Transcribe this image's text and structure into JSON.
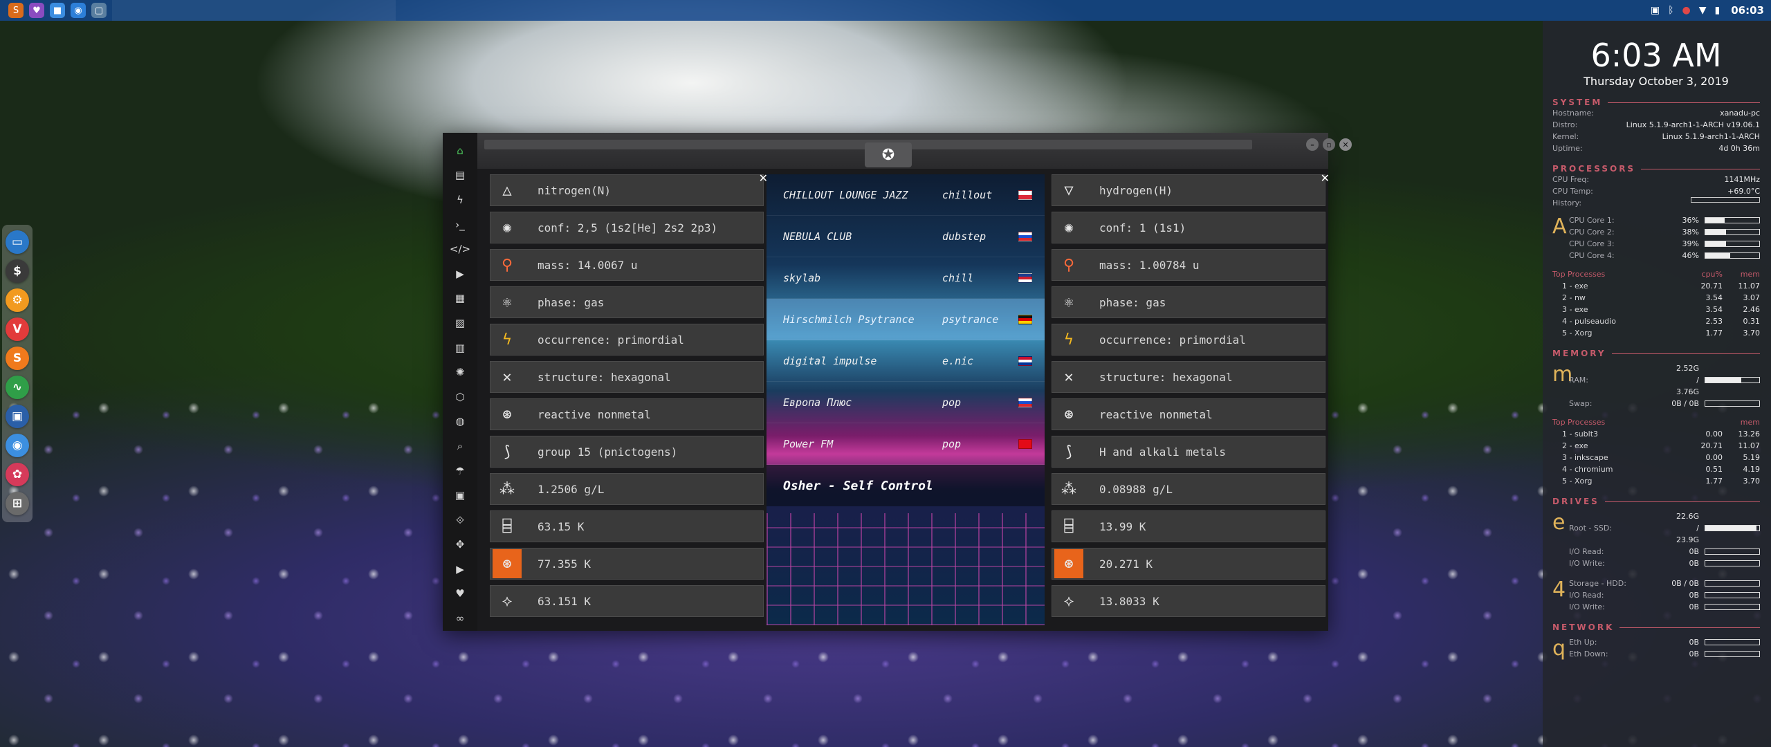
{
  "topbar": {
    "clock": "06:03",
    "launchers": [
      {
        "icon": "app-icon",
        "glyph": "S",
        "color": "#d96b1c"
      },
      {
        "icon": "shield-icon",
        "glyph": "♥",
        "color": "#8a4cc0"
      },
      {
        "icon": "folder-icon",
        "glyph": "■",
        "color": "#3b8de0"
      },
      {
        "icon": "chrome-icon",
        "glyph": "◉",
        "color": "#2d7fd8"
      },
      {
        "icon": "window-icon",
        "glyph": "▢",
        "color": "#5a7fa0"
      }
    ]
  },
  "dock": {
    "items": [
      {
        "icon": "files-icon",
        "glyph": "▭",
        "color": "#2a78c8"
      },
      {
        "icon": "money-icon",
        "glyph": "$",
        "color": "#3a3a3a"
      },
      {
        "icon": "settings-icon",
        "glyph": "⚙",
        "color": "#f29a1f"
      },
      {
        "icon": "vivaldi-icon",
        "glyph": "V",
        "color": "#e23b3b"
      },
      {
        "icon": "sublime-icon",
        "glyph": "S",
        "color": "#f07a1c"
      },
      {
        "icon": "monitor-icon",
        "glyph": "∿",
        "color": "#2f9e48"
      },
      {
        "icon": "display-icon",
        "glyph": "▣",
        "color": "#2a5fa8"
      },
      {
        "icon": "browser-icon",
        "glyph": "◉",
        "color": "#3c8fe0"
      },
      {
        "icon": "badge-icon",
        "glyph": "✿",
        "color": "#d63a5a"
      },
      {
        "icon": "grid-icon",
        "glyph": "⊞",
        "color": "#6a6a6a"
      }
    ]
  },
  "conky": {
    "time": "6:03 AM",
    "date": "Thursday October  3, 2019",
    "system_title": "SYSTEM",
    "system": [
      {
        "k": "Hostname:",
        "v": "xanadu-pc"
      },
      {
        "k": "Distro:",
        "v": "Linux 5.1.9-arch1-1-ARCH v19.06.1"
      },
      {
        "k": "Kernel:",
        "v": "Linux 5.1.9-arch1-1-ARCH"
      },
      {
        "k": "Uptime:",
        "v": "4d 0h 36m"
      }
    ],
    "processors_title": "PROCESSORS",
    "processors": [
      {
        "k": "CPU Freq:",
        "v": "1141MHz"
      },
      {
        "k": "CPU Temp:",
        "v": "+69.0°C"
      },
      {
        "k": "History:",
        "v": ""
      }
    ],
    "cpu_letter": "A",
    "cores": [
      {
        "k": "CPU Core 1:",
        "v": "36%",
        "pct": 36
      },
      {
        "k": "CPU Core 2:",
        "v": "38%",
        "pct": 38
      },
      {
        "k": "CPU Core 3:",
        "v": "39%",
        "pct": 39
      },
      {
        "k": "CPU Core 4:",
        "v": "46%",
        "pct": 46
      }
    ],
    "top_title": "Top Processes",
    "top_cpu": "cpu%",
    "top_mem": "mem",
    "top": [
      {
        "n": "1 - exe",
        "c": "20.71",
        "m": "11.07"
      },
      {
        "n": "2 - nw",
        "c": "3.54",
        "m": "3.07"
      },
      {
        "n": "3 - exe",
        "c": "3.54",
        "m": "2.46"
      },
      {
        "n": "4 - pulseaudio",
        "c": "2.53",
        "m": "0.31"
      },
      {
        "n": "5 - Xorg",
        "c": "1.77",
        "m": "3.70"
      }
    ],
    "memory_title": "MEMORY",
    "mem_letter": "m",
    "mem": [
      {
        "k": "RAM:",
        "v": "2.52G / 3.76G",
        "pct": 67
      },
      {
        "k": "Swap:",
        "v": "0B / 0B",
        "pct": 0
      }
    ],
    "top_mem_title": "Top Processes",
    "top_mem_head": "mem",
    "topmem": [
      {
        "n": "1 - sublt3",
        "c": "0.00",
        "m": "13.26"
      },
      {
        "n": "2 - exe",
        "c": "20.71",
        "m": "11.07"
      },
      {
        "n": "3 - inkscape",
        "c": "0.00",
        "m": "5.19"
      },
      {
        "n": "4 - chromium",
        "c": "0.51",
        "m": "4.19"
      },
      {
        "n": "5 - Xorg",
        "c": "1.77",
        "m": "3.70"
      }
    ],
    "drives_title": "DRIVES",
    "drive1_letter": "e",
    "drive1": [
      {
        "k": "Root - SSD:",
        "v": "22.6G / 23.9G",
        "pct": 95
      },
      {
        "k": "I/O Read:",
        "v": "0B",
        "pct": 0
      },
      {
        "k": "I/O Write:",
        "v": "0B",
        "pct": 0
      }
    ],
    "drive2_letter": "4",
    "drive2": [
      {
        "k": "Storage - HDD:",
        "v": "0B / 0B",
        "pct": 0
      },
      {
        "k": "I/O Read:",
        "v": "0B",
        "pct": 0
      },
      {
        "k": "I/O Write:",
        "v": "0B",
        "pct": 0
      }
    ],
    "network_title": "NETWORK",
    "net_letter": "q",
    "net": [
      {
        "k": "Eth Up:",
        "v": "0B",
        "pct": 0
      },
      {
        "k": "Eth Down:",
        "v": "0B",
        "pct": 0
      }
    ]
  },
  "window": {
    "sidebar": [
      {
        "icon": "home-icon",
        "glyph": "⌂",
        "active": true
      },
      {
        "icon": "document-icon",
        "glyph": "▤"
      },
      {
        "icon": "bolt-icon",
        "glyph": "ϟ"
      },
      {
        "icon": "terminal-icon",
        "glyph": "›_"
      },
      {
        "icon": "code-icon",
        "glyph": "</>"
      },
      {
        "icon": "play-icon",
        "glyph": "▶"
      },
      {
        "icon": "gallery-icon",
        "glyph": "▦"
      },
      {
        "icon": "image-icon",
        "glyph": "▨"
      },
      {
        "icon": "news-icon",
        "glyph": "▥"
      },
      {
        "icon": "atom-icon",
        "glyph": "✺"
      },
      {
        "icon": "hexagon-icon",
        "glyph": "⬡"
      },
      {
        "icon": "globe-icon",
        "glyph": "◍"
      },
      {
        "icon": "search-icon",
        "glyph": "⌕"
      },
      {
        "icon": "umbrella-icon",
        "glyph": "☂"
      },
      {
        "icon": "contact-icon",
        "glyph": "▣"
      },
      {
        "icon": "link-icon",
        "glyph": "⟐"
      },
      {
        "icon": "expand-icon",
        "glyph": "✥"
      },
      {
        "icon": "youtube-icon",
        "glyph": "▶"
      },
      {
        "icon": "heart-icon",
        "glyph": "♥"
      },
      {
        "icon": "chain-icon",
        "glyph": "∞"
      }
    ],
    "emblem_icon": "rebel-icon",
    "left_panel": [
      {
        "icon": "triangle-up-icon",
        "glyph": "△",
        "label": "nitrogen(N)"
      },
      {
        "icon": "orbit-icon",
        "glyph": "✺",
        "label": "conf: 2,5 (1s2[He] 2s2 2p3)"
      },
      {
        "icon": "pin-icon",
        "glyph": "⚲",
        "label": "mass: 14.0067 u",
        "style": "pin"
      },
      {
        "icon": "atom-icon",
        "glyph": "⚛",
        "label": "phase: gas"
      },
      {
        "icon": "bolt-icon",
        "glyph": "ϟ",
        "label": "occurrence: primordial",
        "style": "bolt"
      },
      {
        "icon": "structure-icon",
        "glyph": "✕",
        "label": "structure: hexagonal"
      },
      {
        "icon": "nucleus-icon",
        "glyph": "⊛",
        "label": "reactive nonmetal"
      },
      {
        "icon": "group-icon",
        "glyph": "⟆",
        "label": "group 15 (pnictogens)"
      },
      {
        "icon": "density-icon",
        "glyph": "⁂",
        "label": "1.2506 g/L"
      },
      {
        "icon": "thermo-icon",
        "glyph": "⌸",
        "label": "63.15 K"
      },
      {
        "icon": "boiling-icon",
        "glyph": "⊛",
        "label": "77.355 K",
        "style": "orange"
      },
      {
        "icon": "molecule-icon",
        "glyph": "⟡",
        "label": "63.151 K"
      }
    ],
    "right_panel": [
      {
        "icon": "triangle-down-icon",
        "glyph": "▽",
        "label": "hydrogen(H)"
      },
      {
        "icon": "orbit-icon",
        "glyph": "✺",
        "label": "conf: 1 (1s1)"
      },
      {
        "icon": "pin-icon",
        "glyph": "⚲",
        "label": "mass: 1.00784 u",
        "style": "pin"
      },
      {
        "icon": "atom-icon",
        "glyph": "⚛",
        "label": "phase: gas"
      },
      {
        "icon": "bolt-icon",
        "glyph": "ϟ",
        "label": "occurrence: primordial",
        "style": "bolt"
      },
      {
        "icon": "structure-icon",
        "glyph": "✕",
        "label": "structure: hexagonal"
      },
      {
        "icon": "nucleus-icon",
        "glyph": "⊛",
        "label": "reactive nonmetal"
      },
      {
        "icon": "group-icon",
        "glyph": "⟆",
        "label": "H and alkali metals"
      },
      {
        "icon": "density-icon",
        "glyph": "⁂",
        "label": "0.08988 g/L"
      },
      {
        "icon": "thermo-icon",
        "glyph": "⌸",
        "label": "13.99 K"
      },
      {
        "icon": "boiling-icon",
        "glyph": "⊛",
        "label": "20.271 K",
        "style": "orange"
      },
      {
        "icon": "molecule-icon",
        "glyph": "⟡",
        "label": "13.8033 K"
      }
    ],
    "stations": [
      {
        "name": "CHILLOUT LOUNGE JAZZ",
        "genre": "chillout",
        "flag": [
          "#ffffff",
          "#dc2b3a"
        ]
      },
      {
        "name": "NEBULA CLUB",
        "genre": "dubstep",
        "flag": [
          "#ffffff",
          "#1b4fd0",
          "#d7282f"
        ]
      },
      {
        "name": "skylab",
        "genre": "chill",
        "flag": [
          "#1e3f8f",
          "#d01c2b",
          "#ffffff"
        ]
      },
      {
        "name": "Hirschmilch Psytrance",
        "genre": "psytrance",
        "flag": [
          "#111111",
          "#dd0000",
          "#ffce00"
        ],
        "selected": true
      },
      {
        "name": "digital impulse",
        "genre": "e.nic",
        "flag": [
          "#c8102e",
          "#ffffff",
          "#003399"
        ]
      },
      {
        "name": "Европа Плюс",
        "genre": "pop",
        "flag": [
          "#ffffff",
          "#1b4fd0",
          "#d7282f"
        ]
      },
      {
        "name": "Power FM",
        "genre": "pop",
        "flag": [
          "#e30a17",
          "#e30a17"
        ]
      }
    ],
    "now_playing": "Osher - Self Control"
  }
}
